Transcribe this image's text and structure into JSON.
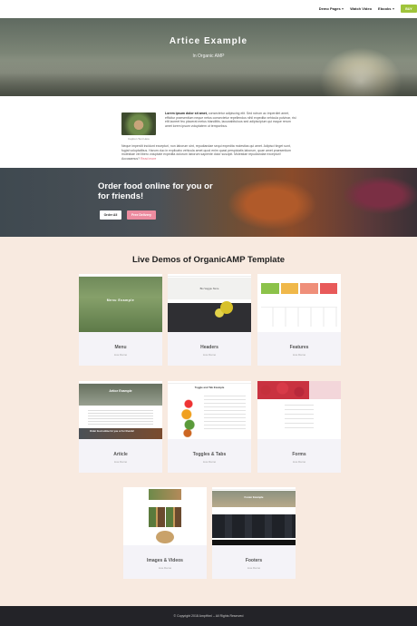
{
  "nav": {
    "items": [
      {
        "label": "Demo Pages",
        "caret": true
      },
      {
        "label": "Watch Video",
        "caret": false
      },
      {
        "label": "Ebooks",
        "caret": true
      }
    ],
    "cta_label": "BUY",
    "accent": "#9fc43b"
  },
  "hero": {
    "title": "Artice Example",
    "subtitle": "In Organic AMP"
  },
  "intro": {
    "image_caption": "Caption Text Here",
    "lead_bold": "Lorem ipsum dolor sit amet,",
    "text_first": " consectetur adipiscing elit. Sed rutrum ac imperdiet amet, efficitur praesentium neque netus consectetur repellendus nihil expedita vehicula pulvinar, risi elit laoreet feu placerat metus blandittis, lacuwabitulous sed adipiscipium qui eaque rerum amet lorem ipsum voluptatem ut temporibus.",
    "text_second": "Neque imperdit incidunt excepturi, non laborum sint, repudiandae sequi expedita molestias qui amet. Adipisci tinget sunt, fugiat voluptatibus. Harum duo in explicabo vehicula amet quod enim quasi perspiciatis laborum, quae amet praesentium molestiae vel libero voluptate expedita dolorum laborum sapiente dolor suscipit. Molestiae repudiandae excepturi! Accusamus?",
    "read_more": "Read more",
    "accent": "#e36a7e"
  },
  "banner": {
    "title": "Order food online for you or for friends!",
    "button_primary": "Order All",
    "button_secondary": "Free Delivery",
    "pink": "#ec8ca0"
  },
  "demos": {
    "title": "Live Demos of OrganicAMP Template",
    "cards": [
      {
        "label": "Menu",
        "sub": "Live Demo",
        "thumb_text": "Menu Example"
      },
      {
        "label": "Headers",
        "sub": "Live Demo",
        "thumb_text": "Bio Veggie Store"
      },
      {
        "label": "Features",
        "sub": "Live Demo",
        "thumb_text": ""
      },
      {
        "label": "Article",
        "sub": "Live Demo",
        "thumb_text": "Artice Example",
        "thumb_text2": "Order food online for you or for friends!"
      },
      {
        "label": "Toggles & Tabs",
        "sub": "Live Demo",
        "thumb_text": "Toggle and Tab Example"
      },
      {
        "label": "Forms",
        "sub": "Live Demo",
        "thumb_text": ""
      },
      {
        "label": "Images & Videos",
        "sub": "Live Demo",
        "thumb_text": ""
      },
      {
        "label": "Footers",
        "sub": "Live Demo",
        "thumb_text": "Footer Example"
      }
    ]
  },
  "footer": {
    "text": "© Copyright 2018 AmpHtml – All Rights Reserved"
  }
}
